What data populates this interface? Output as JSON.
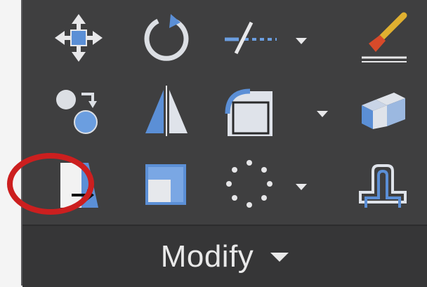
{
  "panel": {
    "title": "Modify",
    "tools": [
      {
        "name": "move",
        "icon": "move-icon",
        "has_dropdown": false
      },
      {
        "name": "rotate",
        "icon": "rotate-icon",
        "has_dropdown": false
      },
      {
        "name": "trim",
        "icon": "trim-icon",
        "has_dropdown": true
      },
      {
        "name": "erase",
        "icon": "erase-brush-icon",
        "has_dropdown": false
      },
      {
        "name": "copy",
        "icon": "copy-icon",
        "has_dropdown": false
      },
      {
        "name": "mirror",
        "icon": "mirror-icon",
        "has_dropdown": false
      },
      {
        "name": "fillet",
        "icon": "fillet-icon",
        "has_dropdown": true
      },
      {
        "name": "explode",
        "icon": "explode-icon",
        "has_dropdown": false
      },
      {
        "name": "stretch",
        "icon": "stretch-icon",
        "has_dropdown": false
      },
      {
        "name": "scale",
        "icon": "scale-icon",
        "has_dropdown": false
      },
      {
        "name": "array",
        "icon": "array-icon",
        "has_dropdown": true
      },
      {
        "name": "offset",
        "icon": "offset-icon",
        "has_dropdown": false
      }
    ],
    "highlighted_tool": "stretch"
  },
  "colors": {
    "panel_bg": "#3f3f40",
    "footer_bg": "#363637",
    "icon_blue": "#5b8fd6",
    "icon_light": "#dfe3ea",
    "highlight_red": "#cc1f1f"
  }
}
